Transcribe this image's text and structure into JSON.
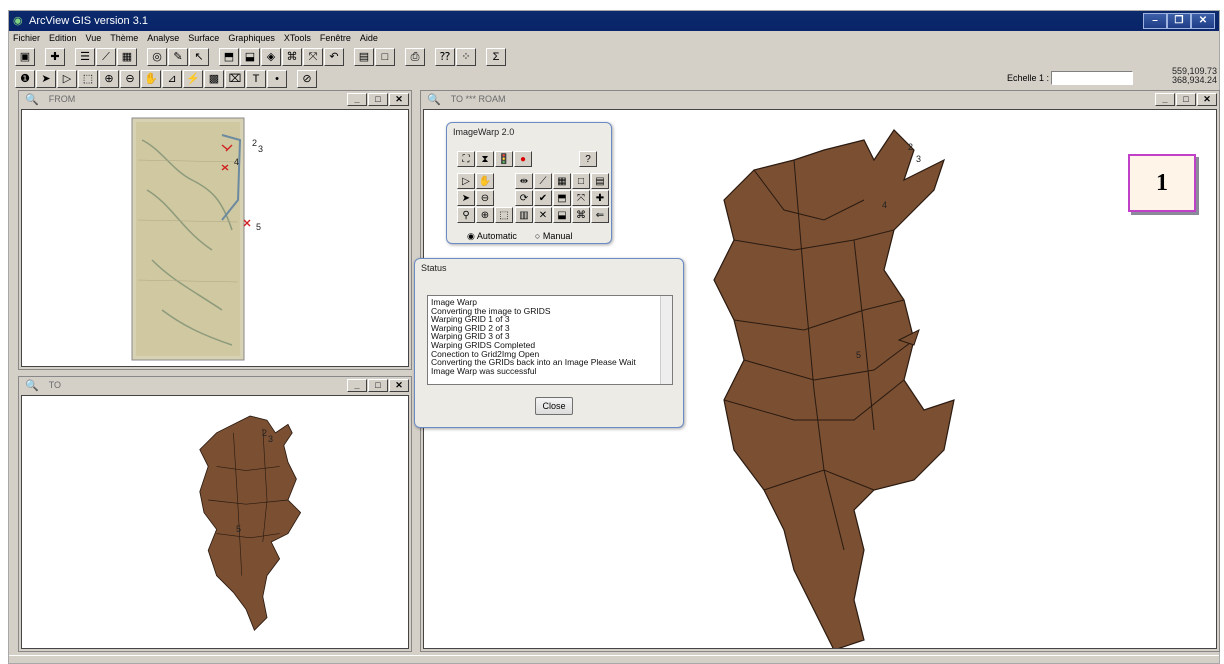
{
  "app": {
    "title": "ArcView GIS version 3.1"
  },
  "menu": [
    "Fichier",
    "Edition",
    "Vue",
    "Thème",
    "Analyse",
    "Surface",
    "Graphiques",
    "XTools",
    "Fenêtre",
    "Aide"
  ],
  "toolbar1": [
    "save-icon",
    "add-theme-icon",
    "theme-properties-icon",
    "edit-legend-icon",
    "open-table-icon",
    "find-icon",
    "query-icon",
    "locate-icon",
    "select-by-theme-icon",
    "clear-selection-icon",
    "zoom-full-icon",
    "zoom-theme-icon",
    "zoom-selected-icon",
    "zoom-previous-icon",
    "layout-icon",
    "layout-frame-icon",
    "print-icon",
    "help-icon",
    "hotlink-icon",
    "sigma-icon"
  ],
  "toolbar2": [
    "identify-icon",
    "pointer-icon",
    "vertex-edit-icon",
    "select-icon",
    "zoom-in-icon",
    "zoom-out-icon",
    "pan-icon",
    "measure-icon",
    "hotlink-tool-icon",
    "area-of-interest-icon",
    "label-icon",
    "text-icon",
    "draw-point-icon",
    "snap-icon"
  ],
  "scale": {
    "label": "Echelle 1 :",
    "value": ""
  },
  "coords": {
    "x": "559,109.73",
    "y": "368,934.24"
  },
  "windows": {
    "from": {
      "title": "FROM"
    },
    "to": {
      "title": "TO"
    },
    "roam": {
      "title": "TO *** ROAM"
    }
  },
  "imagewarp": {
    "title": "ImageWarp 2.0",
    "help_label": "?",
    "radio_automatic": "Automatic",
    "radio_manual": "Manual"
  },
  "status": {
    "title": "Status",
    "lines": [
      "Image Warp",
      "Converting the image to GRIDS",
      "Warping GRID 1 of 3",
      "Warping GRID 2 of 3",
      "Warping GRID 3 of 3",
      "Warping GRIDS Completed",
      "Conection to Grid2Img Open",
      "Converting the GRIDs back into an Image Please Wait",
      "Image Warp was successful"
    ],
    "close_label": "Close"
  },
  "control_points": [
    "2",
    "3",
    "4",
    "5"
  ],
  "badge": "1",
  "colors": {
    "map_fill": "#7a4f32",
    "map_outline": "#2a1a10",
    "title_bg": "#0a246a",
    "badge_border": "#c040c8"
  }
}
